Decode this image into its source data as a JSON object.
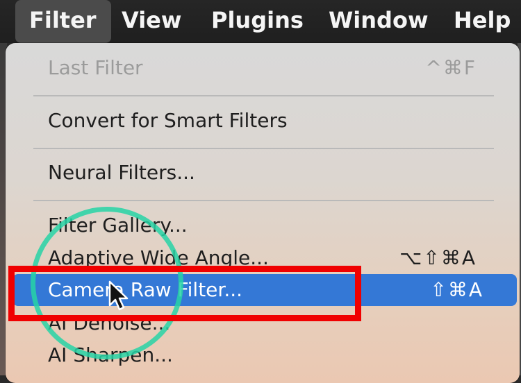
{
  "menubar": {
    "items": [
      {
        "label": "Filter"
      },
      {
        "label": "View"
      },
      {
        "label": "Plugins"
      },
      {
        "label": "Window"
      },
      {
        "label": "Help"
      }
    ]
  },
  "filter_menu": {
    "items": [
      {
        "label": "Last Filter",
        "shortcut": "^⌘F",
        "enabled": false
      },
      {
        "label": "Convert for Smart Filters",
        "shortcut": ""
      },
      {
        "label": "Neural Filters...",
        "shortcut": ""
      },
      {
        "label": "Filter Gallery...",
        "shortcut": ""
      },
      {
        "label": "Adaptive Wide Angle...",
        "shortcut": "⌥⇧⌘A"
      },
      {
        "label": "Camera Raw Filter...",
        "shortcut": "⇧⌘A",
        "selected": true
      },
      {
        "label": "AI Denoise...",
        "shortcut": ""
      },
      {
        "label": "AI Sharpen...",
        "shortcut": ""
      }
    ]
  },
  "colors": {
    "selection": "#3478d6",
    "highlight_box": "#f00000",
    "highlight_circle": "#27d3a6"
  },
  "icons": {
    "cursor": "arrow-cursor-icon"
  }
}
